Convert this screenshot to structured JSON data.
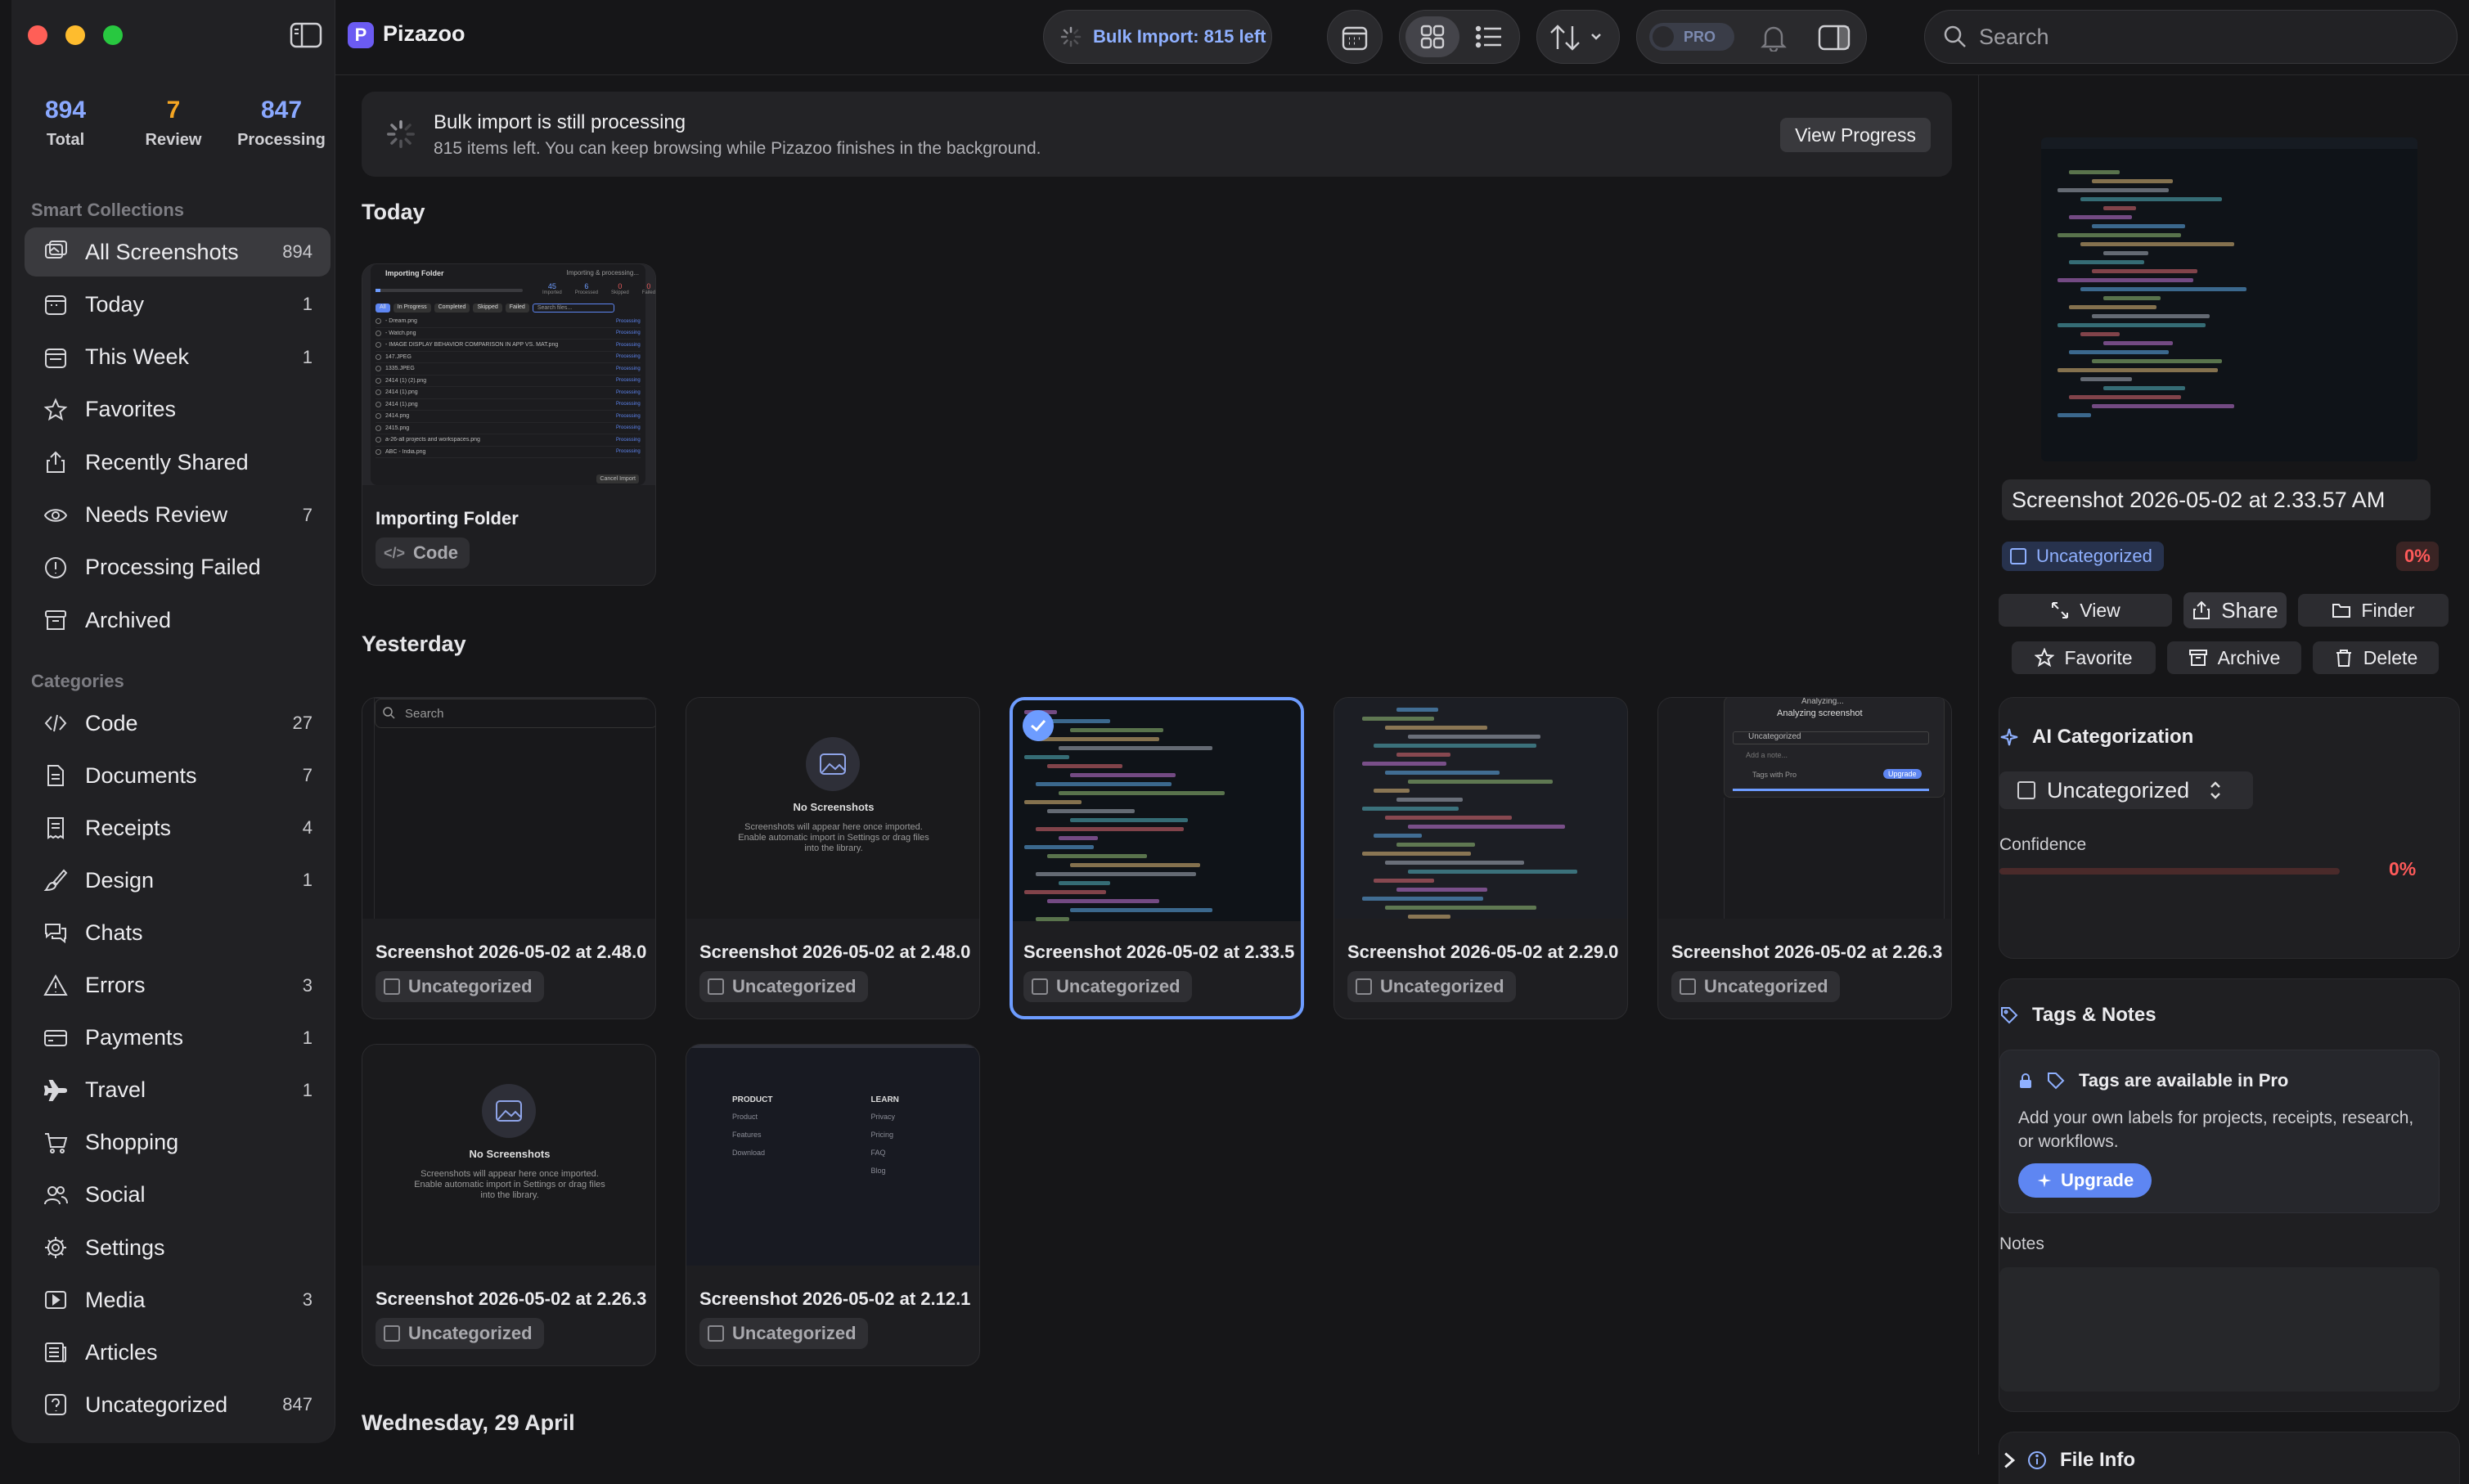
{
  "app": {
    "name": "Pizazoo",
    "logo_letter": "P"
  },
  "toolbar": {
    "bulk_import": "Bulk Import: 815 left",
    "pro_badge": "PRO",
    "search_placeholder": "Search"
  },
  "stats": [
    {
      "value": "894",
      "label": "Total"
    },
    {
      "value": "7",
      "label": "Review"
    },
    {
      "value": "847",
      "label": "Processing"
    }
  ],
  "sidebar": {
    "smart_title": "Smart Collections",
    "smart": [
      {
        "label": "All Screenshots",
        "count": "894",
        "icon": "photos-icon"
      },
      {
        "label": "Today",
        "count": "1",
        "icon": "calendar-icon"
      },
      {
        "label": "This Week",
        "count": "1",
        "icon": "calendar-week-icon"
      },
      {
        "label": "Favorites",
        "count": "",
        "icon": "star-icon"
      },
      {
        "label": "Recently Shared",
        "count": "",
        "icon": "share-icon"
      },
      {
        "label": "Needs Review",
        "count": "7",
        "icon": "eye-icon"
      },
      {
        "label": "Processing Failed",
        "count": "",
        "icon": "alert-circle-icon"
      },
      {
        "label": "Archived",
        "count": "",
        "icon": "archive-icon"
      }
    ],
    "cat_title": "Categories",
    "categories": [
      {
        "label": "Code",
        "count": "27",
        "icon": "code-icon"
      },
      {
        "label": "Documents",
        "count": "7",
        "icon": "document-icon"
      },
      {
        "label": "Receipts",
        "count": "4",
        "icon": "receipt-icon"
      },
      {
        "label": "Design",
        "count": "1",
        "icon": "brush-icon"
      },
      {
        "label": "Chats",
        "count": "",
        "icon": "chat-icon"
      },
      {
        "label": "Errors",
        "count": "3",
        "icon": "warning-icon"
      },
      {
        "label": "Payments",
        "count": "1",
        "icon": "card-icon"
      },
      {
        "label": "Travel",
        "count": "1",
        "icon": "airplane-icon"
      },
      {
        "label": "Shopping",
        "count": "",
        "icon": "cart-icon"
      },
      {
        "label": "Social",
        "count": "",
        "icon": "people-icon"
      },
      {
        "label": "Settings",
        "count": "",
        "icon": "gear-icon"
      },
      {
        "label": "Media",
        "count": "3",
        "icon": "play-icon"
      },
      {
        "label": "Articles",
        "count": "",
        "icon": "newspaper-icon"
      },
      {
        "label": "Uncategorized",
        "count": "847",
        "icon": "question-icon"
      }
    ]
  },
  "banner": {
    "title": "Bulk import is still processing",
    "subtitle": "815 items left. You can keep browsing while Pizazoo finishes in the background.",
    "button": "View Progress"
  },
  "sections": {
    "today": "Today",
    "yesterday": "Yesterday",
    "wed": "Wednesday, 29 April"
  },
  "cards": [
    {
      "name": "Importing Folder",
      "tag": "Code"
    },
    {
      "name": "Screenshot 2026-05-02 at 2.48.0",
      "tag": "Uncategorized"
    },
    {
      "name": "Screenshot 2026-05-02 at 2.48.0",
      "tag": "Uncategorized"
    },
    {
      "name": "Screenshot 2026-05-02 at 2.33.5",
      "tag": "Uncategorized"
    },
    {
      "name": "Screenshot 2026-05-02 at 2.29.0",
      "tag": "Uncategorized"
    },
    {
      "name": "Screenshot 2026-05-02 at 2.26.3",
      "tag": "Uncategorized"
    },
    {
      "name": "Screenshot 2026-05-02 at 2.26.3",
      "tag": "Uncategorized"
    },
    {
      "name": "Screenshot 2026-05-02 at 2.12.1",
      "tag": "Uncategorized"
    }
  ],
  "thumbs": {
    "importing": {
      "title": "Importing Folder",
      "status": "Importing & processing...",
      "counts": [
        "45",
        "6",
        "0",
        "0"
      ],
      "count_labels": [
        "Imported",
        "Processed",
        "Skipped",
        "Failed"
      ],
      "filters": [
        "All",
        "In Progress",
        "Completed",
        "Skipped",
        "Failed"
      ],
      "search": "Search files...",
      "files": [
        "- Dream.png",
        "- Watch.png",
        "- IMAGE DISPLAY BEHAVIOR COMPARISON IN APP VS. MAT.png",
        "147.JPEG",
        "1335.JPEG",
        "2414 (1) (2).png",
        "2414 (1).png",
        "2414 (1).png",
        "2414.png",
        "2415.png",
        "a-26-all projects and workspaces.png",
        "ABC - India.png"
      ],
      "cancel": "Cancel Import"
    },
    "search_text": "Search",
    "empty_title": "No Screenshots",
    "empty_body": "Screenshots will appear here once imported. Enable automatic import in Settings or drag files into the library.",
    "analyzing": "Analyzing...",
    "analyzing_title": "Analyzing screenshot",
    "analyzing_cat": "Uncategorized",
    "add_note": "Add a note...",
    "tags_pro": "Tags with Pro",
    "upgrade": "Upgrade",
    "footer_cols": [
      {
        "title": "PRODUCT",
        "items": [
          "Product",
          "Features",
          "Download"
        ]
      },
      {
        "title": "LEARN",
        "items": [
          "Privacy",
          "Pricing",
          "FAQ",
          "Blog"
        ]
      }
    ]
  },
  "detail": {
    "title": "Screenshot 2026-05-02 at 2.33.57 AM",
    "category": "Uncategorized",
    "percent": "0%",
    "actions": [
      "View",
      "Share",
      "Finder",
      "Favorite",
      "Archive",
      "Delete"
    ],
    "ai_title": "AI Categorization",
    "ai_value": "Uncategorized",
    "confidence_label": "Confidence",
    "confidence_value": "0%",
    "confidence": 0,
    "tags_title": "Tags & Notes",
    "pro_title": "Tags are available in Pro",
    "pro_body": "Add your own labels for projects, receipts, research, or workflows.",
    "upgrade": "Upgrade",
    "notes_label": "Notes",
    "file_info": "File Info"
  },
  "colors": {
    "accent": "#6d9cff",
    "bulk": "#8fb0ff",
    "review": "#f5a623",
    "danger": "#ff5a5a"
  }
}
